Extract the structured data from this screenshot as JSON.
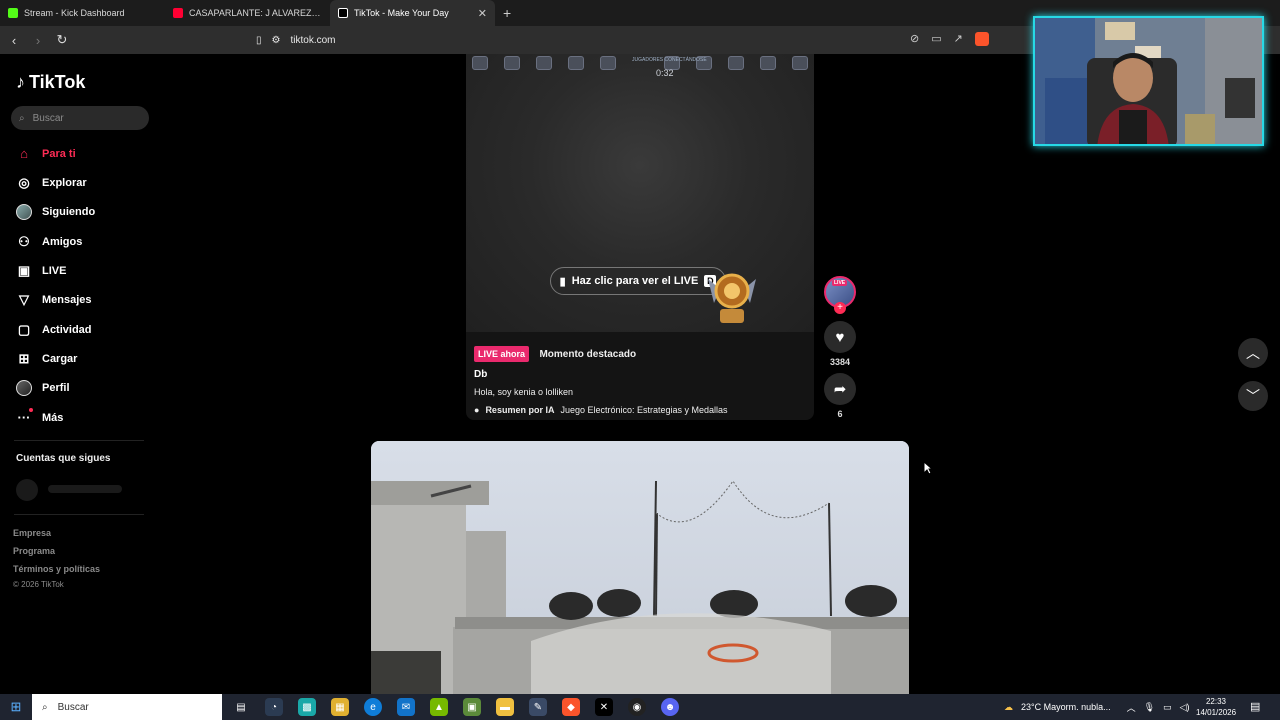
{
  "browser": {
    "tabs": [
      {
        "title": "Stream - Kick Dashboard",
        "favicon_color": "#53fc18",
        "active": false
      },
      {
        "title": "CASAPARLANTE: J ALVAREZ - YouTube",
        "favicon_color": "#ff0033",
        "active": false
      },
      {
        "title": "TikTok - Make Your Day",
        "favicon_color": "#ffffff",
        "active": true
      }
    ],
    "new_tab": "+",
    "url": "tiktok.com"
  },
  "sidebar": {
    "logo_text": "TikTok",
    "search_placeholder": "Buscar",
    "nav": [
      {
        "label": "Para ti",
        "icon": "home-icon",
        "active": true
      },
      {
        "label": "Explorar",
        "icon": "compass-icon"
      },
      {
        "label": "Siguiendo",
        "icon": "following-avatar-icon"
      },
      {
        "label": "Amigos",
        "icon": "friends-icon"
      },
      {
        "label": "LIVE",
        "icon": "live-tv-icon"
      },
      {
        "label": "Mensajes",
        "icon": "send-icon"
      },
      {
        "label": "Actividad",
        "icon": "activity-icon"
      },
      {
        "label": "Cargar",
        "icon": "upload-icon"
      },
      {
        "label": "Perfil",
        "icon": "profile-avatar-icon"
      },
      {
        "label": "Más",
        "icon": "more-icon"
      }
    ],
    "following_title": "Cuentas que sigues",
    "footer": [
      "Empresa",
      "Programa",
      "Términos y políticas"
    ],
    "copyright": "© 2026 TikTok"
  },
  "live_card": {
    "timer": "0:32",
    "hud_caption": "JUGADORES CONECTÁNDOSE",
    "watch_button": "Haz clic para ver el LIVE",
    "badge_letter": "D",
    "live_badge": "LIVE ahora",
    "moment": "Momento destacado",
    "author": "Db",
    "description": "Hola, soy kenia o lolliken",
    "ai_summary_label": "Resumen por IA",
    "ai_summary_topic": "Juego Electrónico: Estrategias y Medallas",
    "avatar_tag": "LIVE",
    "likes": "3384",
    "shares": "6"
  },
  "taskbar": {
    "search_placeholder": "Buscar",
    "weather": "23°C  Mayorm. nubla...",
    "time": "22:33",
    "date": "14/01/2026"
  }
}
